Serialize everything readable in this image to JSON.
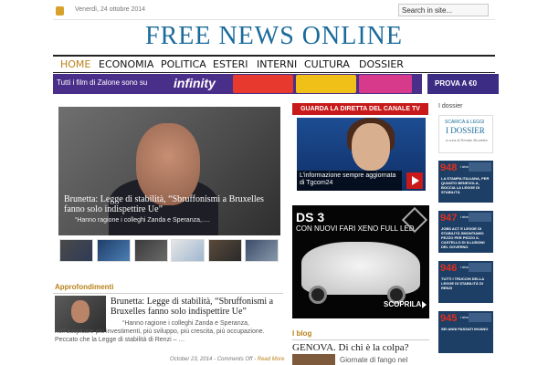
{
  "topbar": {
    "date": "Venerdì, 24 ottobre 2014",
    "search_placeholder": "Search in site...",
    "search_value": "Search in site..."
  },
  "site": {
    "title": "FREE NEWS ONLINE"
  },
  "nav": [
    {
      "label": "HOME",
      "active": true
    },
    {
      "label": "ECONOMIA"
    },
    {
      "label": "POLITICA"
    },
    {
      "label": "ESTERI"
    },
    {
      "label": "INTERNI"
    },
    {
      "label": "CULTURA"
    },
    {
      "label": "DOSSIER"
    }
  ],
  "banner": {
    "text": "Tutti i film di Zalone sono su",
    "brand": "infinity",
    "cta": "PROVA A €0",
    "colors": {
      "bg": "#4a2f8a",
      "cta_bg": "#3c2c83"
    }
  },
  "featured": {
    "title": "Brunetta: Legge di stabilità, “Sbruffonismi a Bruxelles fanno solo indispettire Ue”",
    "excerpt": "“Hanno ragione i colleghi Zanda e Speranza,…."
  },
  "approfondimenti": {
    "heading": "Approfondimenti",
    "title": "Brunetta: Legge di stabilità, “Sbruffonismi a Bruxelles fanno solo indispettire Ue”",
    "body": "“Hanno ragione i colleghi Zanda e Speranza, nell’auspicare più investimenti, più sviluppo, più crescita, più occupazione. Peccato che la Legge di stabilità di Renzi – …",
    "date": "October 23, 2014",
    "comments": "Comments Off",
    "more": "Read More"
  },
  "tv": {
    "heading": "GUARDA LA DIRETTA DEL CANALE TV",
    "caption": "L’informazione sempre aggiornata di Tgcom24"
  },
  "ds3": {
    "title": "DS 3",
    "subtitle": "CON NUOVI FARI XENO FULL LED",
    "cta": "SCOPRILA"
  },
  "blog": {
    "heading": "I blog",
    "title": "GENOVA. Di chi è la colpa?",
    "snippet": "Giornate di fango nel"
  },
  "dossier": {
    "heading": "I dossier",
    "cover": {
      "line1": "SCARICA & LEGGI",
      "line2": "I DOSSIER",
      "line3": "a cura di Renato Brunetta"
    },
    "cards": [
      {
        "num": "948",
        "label": "i dossier",
        "text": "LA STAMPA ITALIANA, PER QUANTO BENEVOLA, BOCCIA LA LEGGE DI STABILITÀ"
      },
      {
        "num": "947",
        "label": "i dossier",
        "text": "JOBS ACT E LEGGE DI STABILITÀ SMONTIAMO PEZZO PER PEZZO IL CASTELLO DI ILLUSIONI DEL GOVERNO"
      },
      {
        "num": "946",
        "label": "i dossier",
        "text": "TUTTI I TRUCCHI DELLA LEGGE DI STABILITÀ DI RENZI"
      },
      {
        "num": "945",
        "label": "i dossier",
        "text": "SEI ANNI PASSATI INVANO"
      }
    ]
  }
}
